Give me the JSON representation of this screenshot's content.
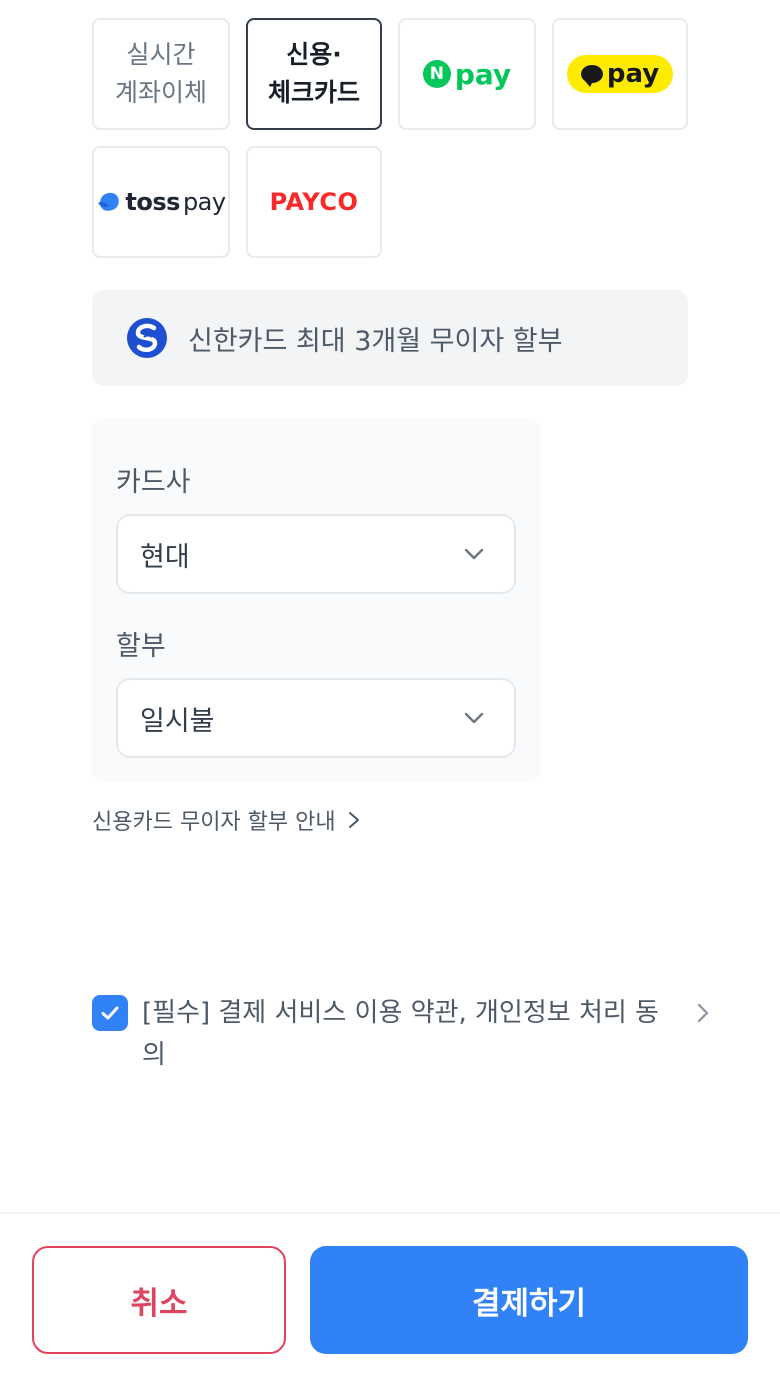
{
  "payment_methods": {
    "realtime_transfer_label": "실시간\n계좌이체",
    "card_label": "신용·\n체크카드",
    "npay_badge": "N",
    "npay_label": "pay",
    "kakaopay_label": "pay",
    "toss_label_bold": "toss",
    "toss_label_rest": "pay",
    "payco_label": "PAYCO"
  },
  "promo": {
    "text": "신한카드 최대 3개월 무이자 할부"
  },
  "card_form": {
    "card_company_label": "카드사",
    "card_company_value": "현대",
    "installment_label": "할부",
    "installment_value": "일시불"
  },
  "guide_link": "신용카드 무이자 할부 안내",
  "agreement": {
    "text": "[필수] 결제 서비스 이용 약관, 개인정보 처리 동의",
    "checked": true
  },
  "buttons": {
    "cancel": "취소",
    "pay": "결제하기"
  },
  "colors": {
    "primary": "#3182f6",
    "cancel": "#e0445f",
    "npay": "#03c75a",
    "kakaopay": "#ffeb00",
    "payco": "#fa2828",
    "toss": "#3182f6"
  },
  "icons": {
    "npay": "naver-pay-logo",
    "kakaopay": "kakao-pay-logo",
    "toss": "toss-pay-logo",
    "shinhan": "shinhan-card-logo",
    "select_chevron": "chevron-down-icon",
    "link_chevron": "chevron-right-icon",
    "checkbox": "check-icon"
  }
}
